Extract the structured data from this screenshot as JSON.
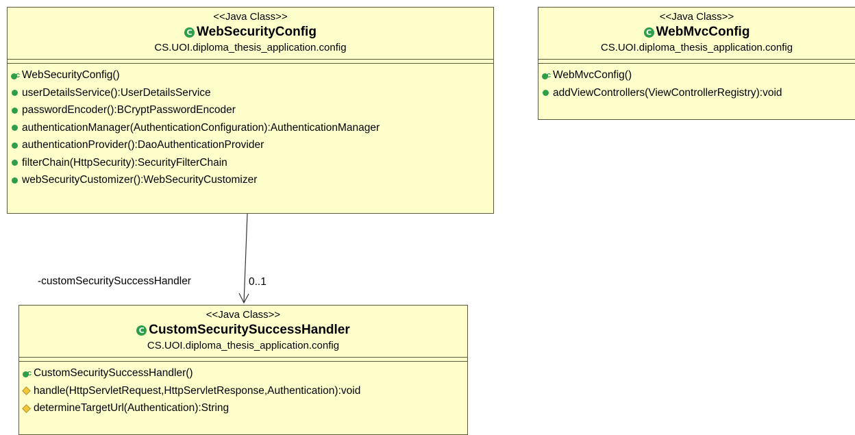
{
  "classes": {
    "web_security_config": {
      "stereotype": "<<Java Class>>",
      "name": "WebSecurityConfig",
      "package": "CS.UOI.diploma_thesis_application.config",
      "members": [
        {
          "vis": "ctor",
          "text": "WebSecurityConfig()"
        },
        {
          "vis": "public",
          "text": "userDetailsService():UserDetailsService"
        },
        {
          "vis": "public",
          "text": "passwordEncoder():BCryptPasswordEncoder"
        },
        {
          "vis": "public",
          "text": "authenticationManager(AuthenticationConfiguration):AuthenticationManager"
        },
        {
          "vis": "public",
          "text": "authenticationProvider():DaoAuthenticationProvider"
        },
        {
          "vis": "public",
          "text": "filterChain(HttpSecurity):SecurityFilterChain"
        },
        {
          "vis": "public",
          "text": "webSecurityCustomizer():WebSecurityCustomizer"
        }
      ]
    },
    "web_mvc_config": {
      "stereotype": "<<Java Class>>",
      "name": "WebMvcConfig",
      "package": "CS.UOI.diploma_thesis_application.config",
      "members": [
        {
          "vis": "ctor",
          "text": "WebMvcConfig()"
        },
        {
          "vis": "public",
          "text": "addViewControllers(ViewControllerRegistry):void"
        }
      ]
    },
    "custom_security_success_handler": {
      "stereotype": "<<Java Class>>",
      "name": "CustomSecuritySuccessHandler",
      "package": "CS.UOI.diploma_thesis_application.config",
      "members": [
        {
          "vis": "ctor",
          "text": "CustomSecuritySuccessHandler()"
        },
        {
          "vis": "protected",
          "text": "handle(HttpServletRequest,HttpServletResponse,Authentication):void"
        },
        {
          "vis": "protected",
          "text": "determineTargetUrl(Authentication):String"
        }
      ]
    }
  },
  "association": {
    "role": "-customSecuritySuccessHandler",
    "multiplicity": "0..1"
  },
  "colors": {
    "class_fill": "#ffffcc",
    "class_border": "#5a5a3a",
    "public_icon": "#2f9e4a",
    "protected_icon": "#f2c83a"
  }
}
